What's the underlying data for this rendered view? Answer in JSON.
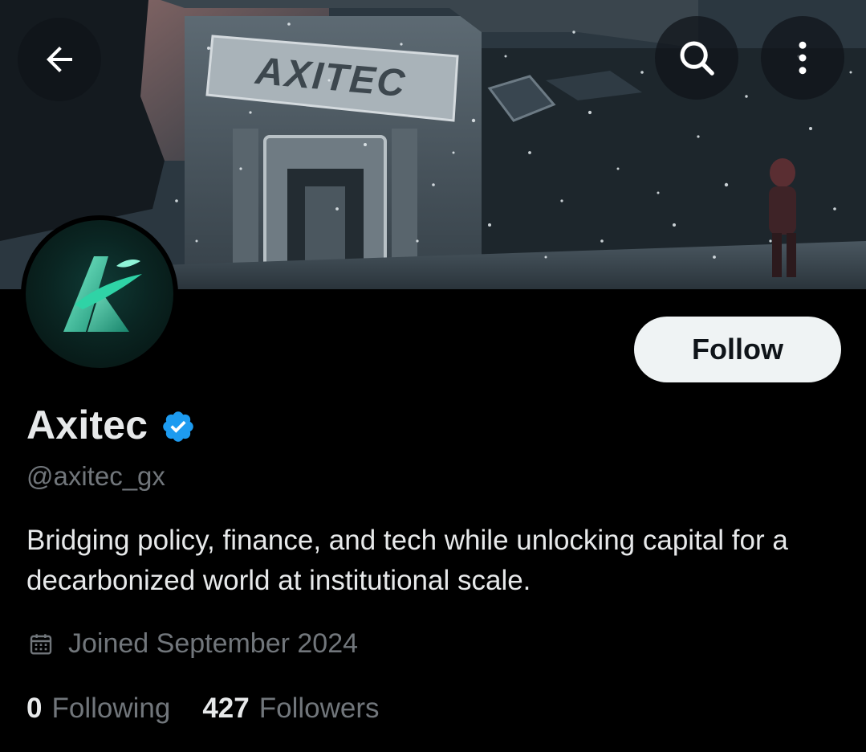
{
  "profile": {
    "display_name": "Axitec",
    "handle": "@axitec_gx",
    "bio": "Bridging policy, finance, and tech while unlocking capital for a decarbonized world at institutional scale.",
    "joined": "Joined September 2024",
    "verified": true
  },
  "banner": {
    "sign_text": "AXITEC"
  },
  "actions": {
    "follow_label": "Follow"
  },
  "stats": {
    "following_count": "0",
    "following_label": "Following",
    "followers_count": "427",
    "followers_label": "Followers"
  },
  "icons": {
    "back": "arrow-left-icon",
    "search": "search-icon",
    "more": "more-vertical-icon",
    "verified": "verified-badge-icon",
    "calendar": "calendar-icon"
  },
  "colors": {
    "background": "#000000",
    "primary_text": "#e7e9ea",
    "secondary_text": "#71767b",
    "verified_blue": "#1d9bf0",
    "follow_button_bg": "#eff3f4",
    "avatar_accent": "#2fd3a6"
  }
}
